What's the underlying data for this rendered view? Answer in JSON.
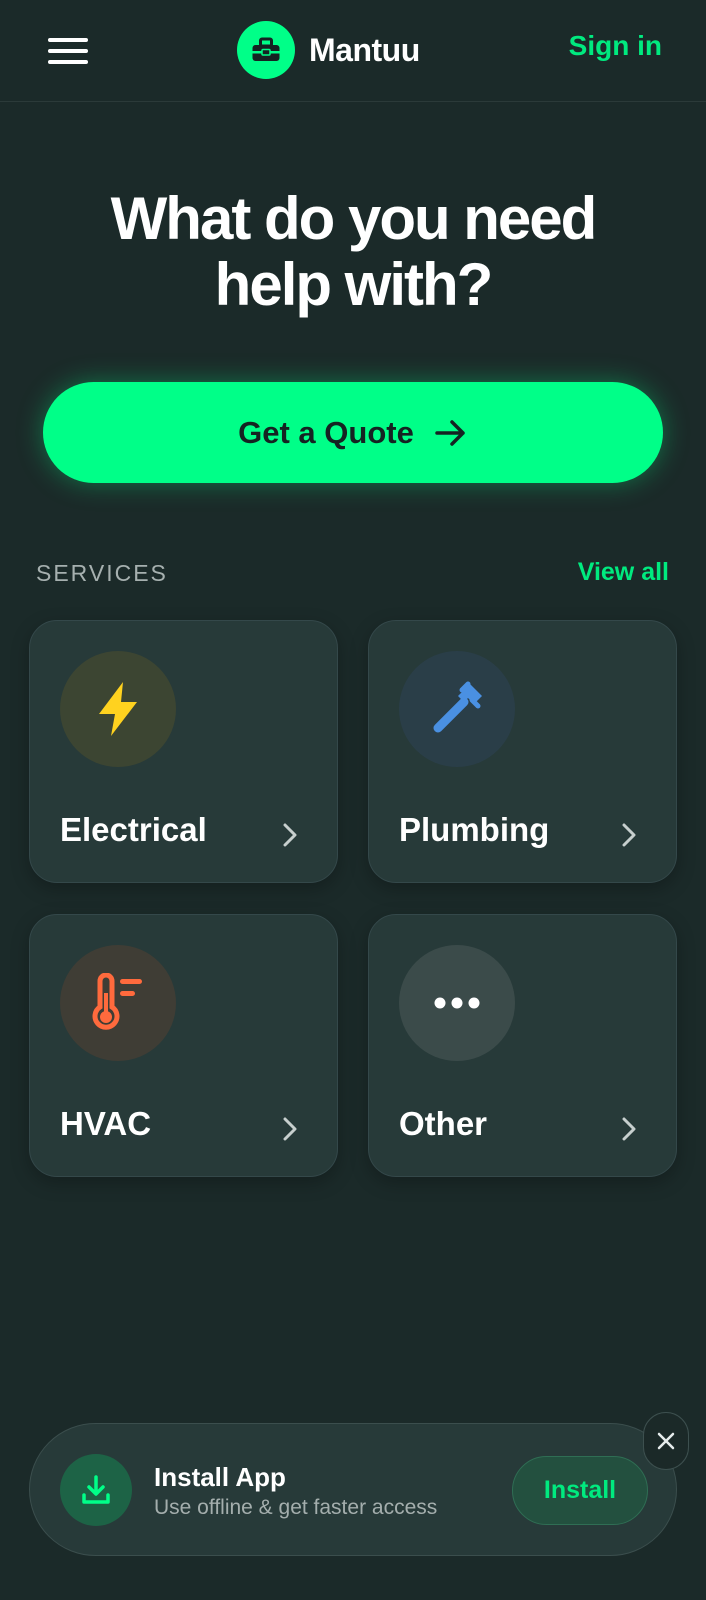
{
  "header": {
    "brand_name": "Mantuu",
    "sign_in": "Sign in"
  },
  "hero": {
    "headline": "What do you need help with?",
    "cta_label": "Get a Quote"
  },
  "services": {
    "section_label": "SERVICES",
    "view_all": "View all",
    "items": [
      {
        "label": "Electrical",
        "icon": "lightning-bolt-icon",
        "accent": "#ffd21f"
      },
      {
        "label": "Plumbing",
        "icon": "pipe-wrench-icon",
        "accent": "#4a90e2"
      },
      {
        "label": "HVAC",
        "icon": "thermometer-icon",
        "accent": "#ff6a3d"
      },
      {
        "label": "Other",
        "icon": "more-dots-icon",
        "accent": "#ffffff"
      }
    ]
  },
  "install_banner": {
    "title": "Install App",
    "subtitle": "Use offline & get faster access",
    "button": "Install"
  },
  "colors": {
    "background": "#1b2a29",
    "accent": "#00ff88",
    "card": "#273a39"
  }
}
